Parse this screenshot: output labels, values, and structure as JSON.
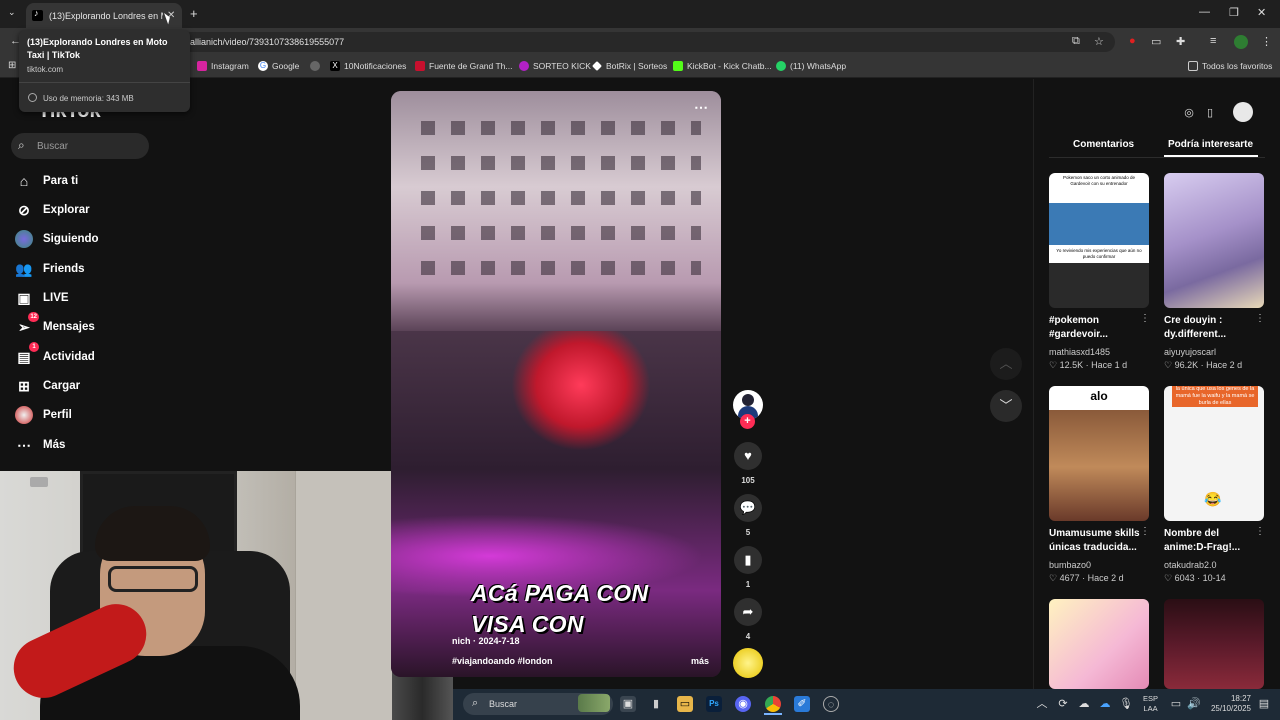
{
  "browser": {
    "tab_title": "(13)Explorando Londres en Moto Taxi | TikTok",
    "tab_title_short": "(13)Explorando Londres en Mo",
    "new_tab": "+",
    "address": "allianich/video/7393107338619555077",
    "bookmarks": [
      {
        "label": "Instagram",
        "icon": "instagram-icon",
        "color": "#d6249f"
      },
      {
        "label": "Google",
        "icon": "google-icon",
        "color": "#4285f4"
      },
      {
        "label": "",
        "icon": "globe-icon",
        "color": "#999999"
      },
      {
        "label": "10Notificaciones",
        "icon": "x-icon",
        "color": "#000000"
      },
      {
        "label": "Fuente de Grand Th...",
        "icon": "flag-icon",
        "color": "#c8102e"
      },
      {
        "label": "SORTEO KICK",
        "icon": "kick-icon",
        "color": "#b321c7"
      },
      {
        "label": "BotRix | Sorteos",
        "icon": "botrix-icon",
        "color": "#ffffff"
      },
      {
        "label": "KickBot - Kick Chatb...",
        "icon": "kickbot-icon",
        "color": "#53fc18"
      },
      {
        "label": "(11) WhatsApp",
        "icon": "whatsapp-icon",
        "color": "#25d366"
      }
    ],
    "all_favorites": "Todos los favoritos"
  },
  "tooltip": {
    "title": "(13)Explorando Londres en Moto Taxi | TikTok",
    "domain": "tiktok.com",
    "memory": "Uso de memoria: 343 MB"
  },
  "tiktok": {
    "logo": "TikTok",
    "search_placeholder": "Buscar",
    "nav": [
      {
        "label": "Para ti",
        "icon": "home-icon"
      },
      {
        "label": "Explorar",
        "icon": "compass-icon"
      },
      {
        "label": "Siguiendo",
        "icon": "following-avatar-icon"
      },
      {
        "label": "Friends",
        "icon": "friends-icon"
      },
      {
        "label": "LIVE",
        "icon": "live-icon"
      },
      {
        "label": "Mensajes",
        "icon": "send-icon",
        "badge": "12"
      },
      {
        "label": "Actividad",
        "icon": "inbox-icon",
        "badge": "1"
      },
      {
        "label": "Cargar",
        "icon": "plus-square-icon"
      },
      {
        "label": "Perfil",
        "icon": "profile-avatar-icon"
      },
      {
        "label": "Más",
        "icon": "more-icon"
      }
    ]
  },
  "video": {
    "caption_line1": "ACá PAGA CON",
    "caption_line2": "VISA CON",
    "author_date": "nich · 2024-7-18",
    "hashtags": "#viajandoando  #london",
    "more": "más",
    "likes": "105",
    "comments": "5",
    "saves": "1",
    "shares": "4"
  },
  "panel": {
    "tab_comments": "Comentarios",
    "tab_interest": "Podría interesarte",
    "items": [
      {
        "title": "#pokemon #gardevoir...",
        "user": "mathiasxd1485",
        "likes": "12.5K",
        "age": "Hace 1 d",
        "thumb_color": "#3b7ab5",
        "thumb_top_text": "Pokemon saco un corto animado de Gardevoir con su entrenador",
        "thumb_bottom_text": "Yo reviviendo mis experiencias que aún no puedo confirmar"
      },
      {
        "title": "Cre douyin : dy.different...",
        "user": "aiyuyujoscarl",
        "likes": "96.2K",
        "age": "Hace 2 d",
        "thumb_color": "#b9a7d8"
      },
      {
        "title": "Umamusume skills únicas traducida...",
        "user": "bumbazo0",
        "likes": "4677",
        "age": "Hace 2 d",
        "thumb_color": "#8a5a3a",
        "thumb_top_text": "alo"
      },
      {
        "title": "Nombre del anime:D-Frag!...",
        "user": "otakudrab2.0",
        "likes": "6043",
        "age": "10-14",
        "thumb_color": "#f4f4f4",
        "thumb_top_text": "la única que usa los genes de la mamá fue la waifu y la mamá se burla de ellas"
      },
      {
        "title": "",
        "user": "",
        "likes": "",
        "age": "",
        "thumb_color": "#f5d7e8"
      },
      {
        "title": "",
        "user": "",
        "likes": "",
        "age": "",
        "thumb_color": "#3a1a2a"
      }
    ]
  },
  "taskbar": {
    "search": "Buscar",
    "lang": "ESP",
    "lang2": "LAA",
    "time": "18:27",
    "date": "25/10/2025"
  }
}
